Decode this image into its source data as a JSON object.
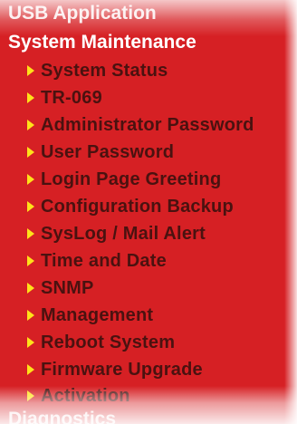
{
  "sidebar": {
    "prev_section": "USB Application",
    "section_title": "System Maintenance",
    "items": [
      {
        "label": "System Status"
      },
      {
        "label": "TR-069"
      },
      {
        "label": "Administrator Password"
      },
      {
        "label": "User Password"
      },
      {
        "label": "Login Page Greeting"
      },
      {
        "label": "Configuration Backup"
      },
      {
        "label": "SysLog / Mail Alert"
      },
      {
        "label": "Time and Date"
      },
      {
        "label": "SNMP"
      },
      {
        "label": "Management"
      },
      {
        "label": "Reboot System"
      },
      {
        "label": "Firmware Upgrade"
      },
      {
        "label": "Activation"
      }
    ],
    "next_section": "Diagnostics"
  },
  "colors": {
    "background": "#d62024",
    "section_text": "#ffffff",
    "item_text": "#4a1210",
    "arrow": "#ffe11a"
  }
}
